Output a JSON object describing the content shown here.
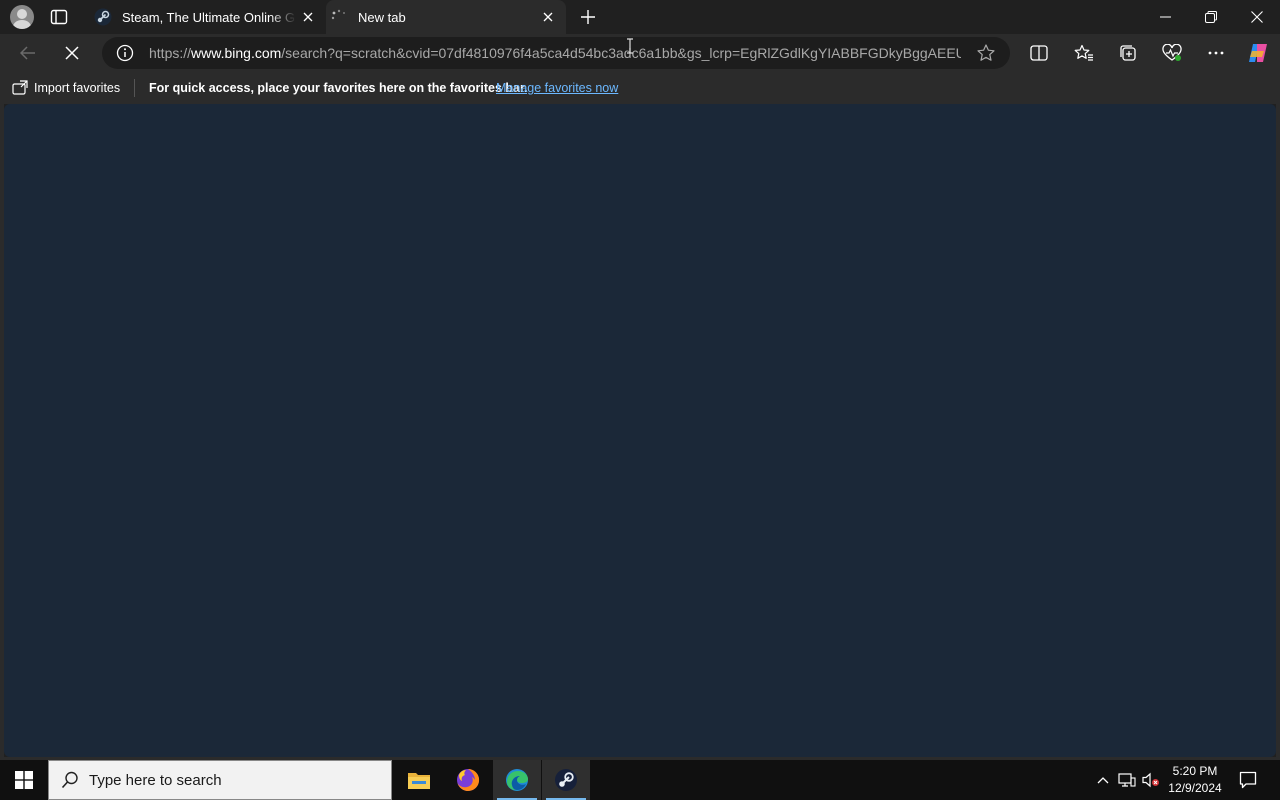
{
  "browser": {
    "tabs": [
      {
        "title": "Steam, The Ultimate Online Game Platform",
        "favicon": "steam-icon",
        "active": false
      },
      {
        "title": "New tab",
        "favicon": "loading-spinner-icon",
        "active": true
      }
    ],
    "address": {
      "scheme": "https://",
      "host": "www.bing.com",
      "path": "/search?q=scratch&cvid=07df4810976f4a5ca4d54bc3adc6a1bb&gs_lcrp=EgRlZGdlKgYIABBFGDkyBggAEEU..."
    },
    "favorites_bar": {
      "import_label": "Import favorites",
      "message": "For quick access, place your favorites here on the favorites bar.",
      "manage_link": "Manage favorites now"
    }
  },
  "content": {
    "background": "#1b2838"
  },
  "taskbar": {
    "search_placeholder": "Type here to search",
    "apps": [
      "file-explorer-icon",
      "firefox-icon",
      "edge-icon",
      "steam-icon"
    ],
    "time": "5:20 PM",
    "date": "12/9/2024"
  },
  "colors": {
    "accent": "#6cb8ff",
    "taskbar_underline": "#76b9ed",
    "chrome_dark": "#202020",
    "toolbar": "#2b2b2b"
  }
}
